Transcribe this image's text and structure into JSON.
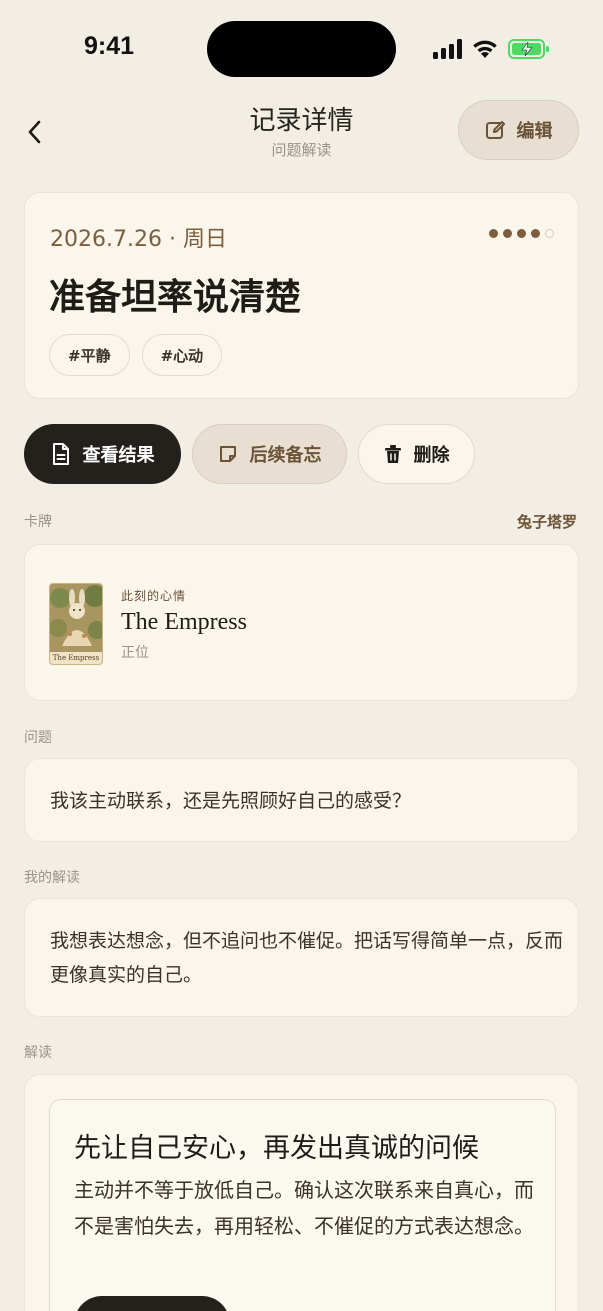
{
  "status": {
    "time": "9:41"
  },
  "header": {
    "title": "记录详情",
    "subtitle": "问题解读",
    "edit_label": "编辑"
  },
  "summary": {
    "date": "2026.7.26 · 周日",
    "rating": 4,
    "rating_max": 5,
    "title": "准备坦率说清楚",
    "tags": [
      "#平静",
      "#心动"
    ]
  },
  "actions": {
    "view_label": "查看结果",
    "note_label": "后续备忘",
    "delete_label": "删除"
  },
  "cards_section": {
    "label": "卡牌",
    "deck": "兔子塔罗",
    "card_caption": "The Empress",
    "mood_label": "此刻的心情",
    "card_name": "The Empress",
    "orientation": "正位"
  },
  "question_section": {
    "label": "问题",
    "text": "我该主动联系，还是先照顾好自己的感受？"
  },
  "my_reading_section": {
    "label": "我的解读",
    "text": "我想表达想念，但不追问也不催促。把话写得简单一点，反而更像真实的自己。"
  },
  "interpretation_section": {
    "label": "解读",
    "title": "先让自己安心，再发出真诚的问候",
    "body": "主动并不等于放低自己。确认这次联系来自真心，而不是害怕失去，再用轻松、不催促的方式表达想念。"
  },
  "colors": {
    "accent": "#7b5e3d",
    "background": "#f3eee4",
    "dark_button": "#24201c"
  }
}
